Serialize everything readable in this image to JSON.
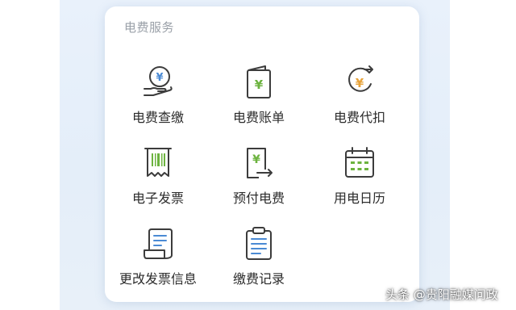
{
  "section_title": "电费服务",
  "services": [
    {
      "label": "电费查缴",
      "icon": "yen-hand-icon"
    },
    {
      "label": "电费账单",
      "icon": "yen-wallet-icon"
    },
    {
      "label": "电费代扣",
      "icon": "yen-cycle-icon"
    },
    {
      "label": "电子发票",
      "icon": "barcode-receipt-icon"
    },
    {
      "label": "预付电费",
      "icon": "yen-prepay-icon"
    },
    {
      "label": "用电日历",
      "icon": "calendar-icon"
    },
    {
      "label": "更改发票信息",
      "icon": "edit-invoice-icon"
    },
    {
      "label": "缴费记录",
      "icon": "clipboard-record-icon"
    }
  ],
  "watermark": "头条 @贵阳融媒问政",
  "colors": {
    "icon_stroke": "#3c3c3c",
    "accent_green": "#6cb33f",
    "accent_blue": "#4a8ad4",
    "accent_orange": "#e8a33a"
  }
}
